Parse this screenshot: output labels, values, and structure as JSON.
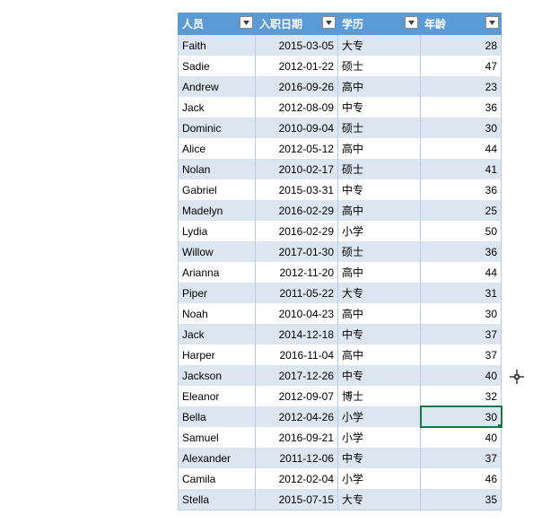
{
  "headers": {
    "c1": "人员",
    "c2": "入职日期",
    "c3": "学历",
    "c4": "年龄"
  },
  "rows": [
    {
      "name": "Faith",
      "hire": "2015-03-05",
      "edu": "大专",
      "age": 28
    },
    {
      "name": "Sadie",
      "hire": "2012-01-22",
      "edu": "硕士",
      "age": 47
    },
    {
      "name": "Andrew",
      "hire": "2016-09-26",
      "edu": "高中",
      "age": 23
    },
    {
      "name": "Jack",
      "hire": "2012-08-09",
      "edu": "中专",
      "age": 36
    },
    {
      "name": "Dominic",
      "hire": "2010-09-04",
      "edu": "硕士",
      "age": 30
    },
    {
      "name": "Alice",
      "hire": "2012-05-12",
      "edu": "高中",
      "age": 44
    },
    {
      "name": "Nolan",
      "hire": "2010-02-17",
      "edu": "硕士",
      "age": 41
    },
    {
      "name": "Gabriel",
      "hire": "2015-03-31",
      "edu": "中专",
      "age": 36
    },
    {
      "name": "Madelyn",
      "hire": "2016-02-29",
      "edu": "高中",
      "age": 25
    },
    {
      "name": "Lydia",
      "hire": "2016-02-29",
      "edu": "小学",
      "age": 50
    },
    {
      "name": "Willow",
      "hire": "2017-01-30",
      "edu": "硕士",
      "age": 36
    },
    {
      "name": "Arianna",
      "hire": "2012-11-20",
      "edu": "高中",
      "age": 44
    },
    {
      "name": "Piper",
      "hire": "2011-05-22",
      "edu": "大专",
      "age": 31
    },
    {
      "name": "Noah",
      "hire": "2010-04-23",
      "edu": "高中",
      "age": 30
    },
    {
      "name": "Jack",
      "hire": "2014-12-18",
      "edu": "中专",
      "age": 37
    },
    {
      "name": "Harper",
      "hire": "2016-11-04",
      "edu": "高中",
      "age": 37
    },
    {
      "name": "Jackson",
      "hire": "2017-12-26",
      "edu": "中专",
      "age": 40
    },
    {
      "name": "Eleanor",
      "hire": "2012-09-07",
      "edu": "博士",
      "age": 32
    },
    {
      "name": "Bella",
      "hire": "2012-04-26",
      "edu": "小学",
      "age": 30
    },
    {
      "name": "Samuel",
      "hire": "2016-09-21",
      "edu": "小学",
      "age": 40
    },
    {
      "name": "Alexander",
      "hire": "2011-12-06",
      "edu": "中专",
      "age": 37
    },
    {
      "name": "Camila",
      "hire": "2012-02-04",
      "edu": "小学",
      "age": 46
    },
    {
      "name": "Stella",
      "hire": "2015-07-15",
      "edu": "大专",
      "age": 35
    }
  ],
  "selected_row_index": 18,
  "selected_col": "age"
}
